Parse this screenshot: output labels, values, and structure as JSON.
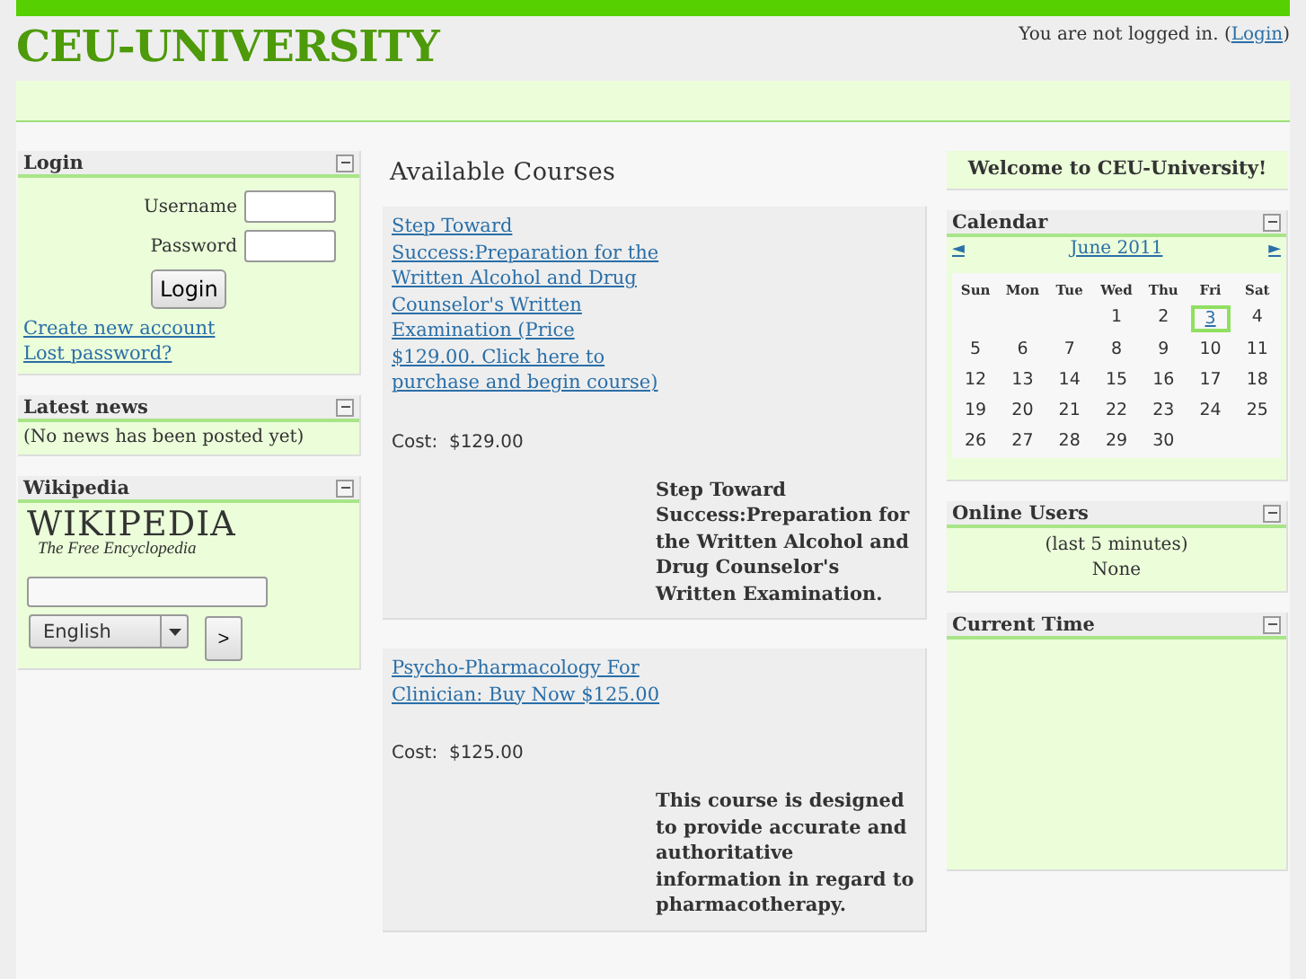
{
  "header": {
    "site_title": "CEU-UNIVERSITY",
    "login_status": "You are not logged in. (",
    "login_link": "Login",
    "login_close": ")"
  },
  "left_blocks": [
    {
      "kind": "login",
      "title": "Login",
      "username_label": "Username",
      "password_label": "Password",
      "button": "Login",
      "links": [
        "Create new account",
        "Lost password?"
      ]
    },
    {
      "kind": "news",
      "title": "Latest news",
      "text": "(No news has been posted yet)"
    },
    {
      "kind": "wikipedia",
      "title": "Wikipedia",
      "logo_title": "WIKIPEDIA",
      "logo_subtitle": "The Free Encyclopedia",
      "language": "English",
      "go_button": ">"
    }
  ],
  "main": {
    "heading": "Available Courses",
    "courses": [
      {
        "link": "Step Toward Success:Preparation for the Written Alcohol and Drug Counselor's Written Examination (Price $129.00. Click here to purchase and begin course)",
        "cost_label": "Cost:",
        "cost": "$129.00",
        "summary": "Step Toward Success:Preparation for the Written Alcohol and Drug Counselor's Written Examination."
      },
      {
        "link": "Psycho-Pharmacology For Clinician:  Buy Now $125.00",
        "cost_label": "Cost:",
        "cost": "$125.00",
        "summary": "This course is designed to provide accurate and authoritative information in regard to pharmacotherapy."
      }
    ]
  },
  "right_blocks": [
    {
      "kind": "welcome",
      "text": "Welcome to CEU-University!"
    },
    {
      "kind": "calendar",
      "title": "Calendar",
      "prev": "◄",
      "month": "June 2011",
      "next": "►",
      "weekdays": [
        "Sun",
        "Mon",
        "Tue",
        "Wed",
        "Thu",
        "Fri",
        "Sat"
      ],
      "weeks": [
        {
          "kind": "first",
          "days": [
            {
              "day": "1",
              "today": false
            },
            {
              "day": "2",
              "today": false
            },
            {
              "day": "3",
              "today": true
            },
            {
              "day": "4",
              "today": false
            }
          ]
        },
        {
          "kind": "full",
          "days": [
            {
              "day": "5",
              "today": false
            },
            {
              "day": "6",
              "today": false
            },
            {
              "day": "7",
              "today": false
            },
            {
              "day": "8",
              "today": false
            },
            {
              "day": "9",
              "today": false
            },
            {
              "day": "10",
              "today": false
            },
            {
              "day": "11",
              "today": false
            }
          ]
        },
        {
          "kind": "full",
          "days": [
            {
              "day": "12",
              "today": false
            },
            {
              "day": "13",
              "today": false
            },
            {
              "day": "14",
              "today": false
            },
            {
              "day": "15",
              "today": false
            },
            {
              "day": "16",
              "today": false
            },
            {
              "day": "17",
              "today": false
            },
            {
              "day": "18",
              "today": false
            }
          ]
        },
        {
          "kind": "full",
          "days": [
            {
              "day": "19",
              "today": false
            },
            {
              "day": "20",
              "today": false
            },
            {
              "day": "21",
              "today": false
            },
            {
              "day": "22",
              "today": false
            },
            {
              "day": "23",
              "today": false
            },
            {
              "day": "24",
              "today": false
            },
            {
              "day": "25",
              "today": false
            }
          ]
        },
        {
          "kind": "full",
          "days": [
            {
              "day": "26",
              "today": false
            },
            {
              "day": "27",
              "today": false
            },
            {
              "day": "28",
              "today": false
            },
            {
              "day": "29",
              "today": false
            },
            {
              "day": "30",
              "today": false
            }
          ]
        }
      ]
    },
    {
      "kind": "online",
      "title": "Online Users",
      "lines": [
        "(last 5 minutes)",
        "None"
      ]
    },
    {
      "kind": "time",
      "title": "Current Time"
    }
  ]
}
